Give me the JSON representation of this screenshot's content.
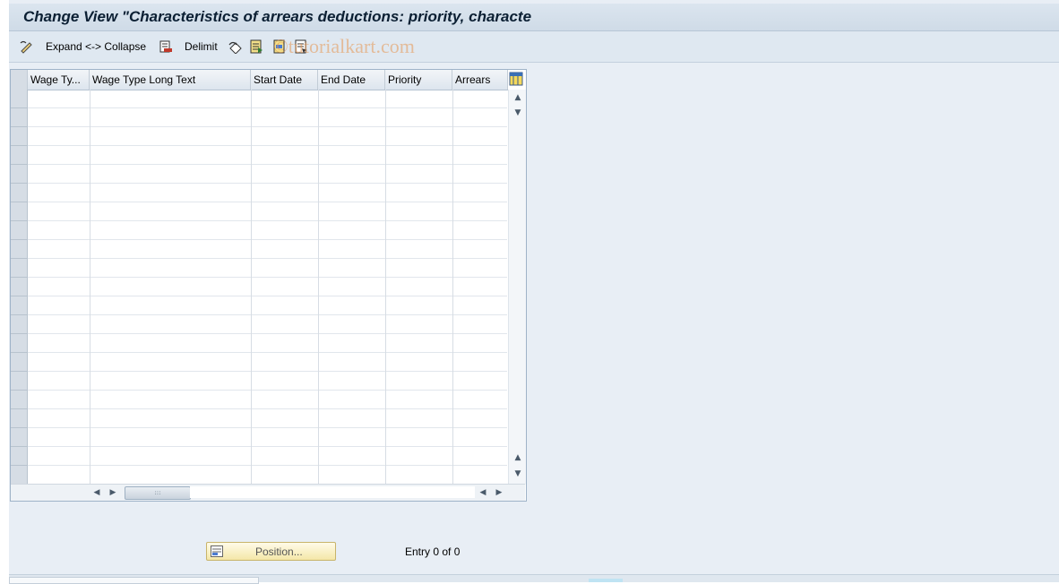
{
  "window": {
    "title": "Change View \"Characteristics of arrears deductions: priority, characte"
  },
  "toolbar": {
    "expand_collapse_label": "Expand <-> Collapse",
    "delimit_label": "Delimit",
    "watermark": "©tutorialkart.com",
    "icons": [
      "edit-pencil-icon",
      "delimit-icon",
      "undo-change-icon",
      "select-all-icon",
      "select-block-icon",
      "deselect-all-icon"
    ]
  },
  "table": {
    "columns": [
      {
        "label": "Wage Ty..."
      },
      {
        "label": "Wage Type Long Text"
      },
      {
        "label": "Start Date"
      },
      {
        "label": "End Date"
      },
      {
        "label": "Priority"
      },
      {
        "label": "Arrears"
      }
    ],
    "rows": [],
    "visible_empty_rows": 21
  },
  "footer": {
    "position_button_label": "Position...",
    "entry_text": "Entry 0 of 0"
  },
  "colors": {
    "background": "#e8eef5",
    "titlebar": "#d4dfea",
    "button_yellow": "#f4e7a8"
  }
}
